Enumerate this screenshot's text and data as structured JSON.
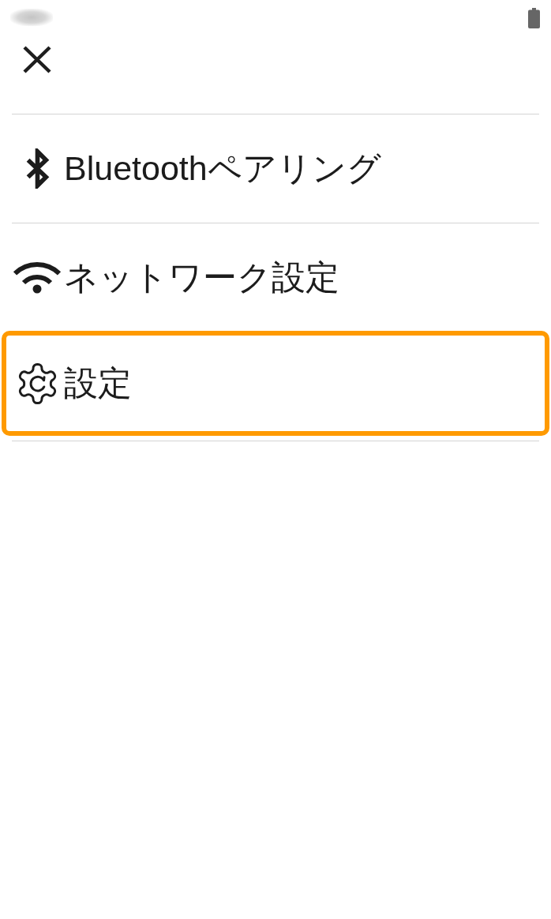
{
  "menu": {
    "items": [
      {
        "kind": "bluetooth",
        "label": "Bluetoothペアリング",
        "highlighted": false
      },
      {
        "kind": "wifi",
        "label": "ネットワーク設定",
        "highlighted": false
      },
      {
        "kind": "gear",
        "label": "設定",
        "highlighted": true
      }
    ]
  }
}
